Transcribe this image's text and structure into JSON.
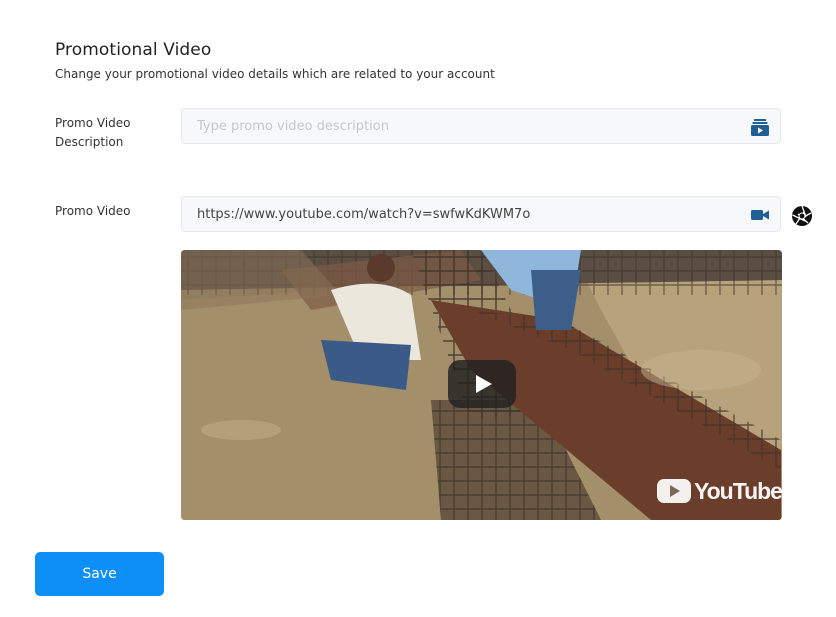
{
  "section": {
    "title": "Promotional Video",
    "subtitle": "Change your promotional video details which are related to your account"
  },
  "description_field": {
    "label": "Promo Video Description",
    "placeholder": "Type promo video description",
    "value": "",
    "icon": "video-library-icon"
  },
  "video_field": {
    "label": "Promo Video",
    "value": "https://www.youtube.com/watch?v=swfwKdKWM7o",
    "icon": "video-camera-icon",
    "side_icon": "aperture-icon"
  },
  "video_preview": {
    "provider_logo": "YouTube",
    "play_icon": "play-icon"
  },
  "actions": {
    "save_label": "Save"
  },
  "colors": {
    "accent": "#0d8ff5",
    "icon": "#1f5f96"
  }
}
